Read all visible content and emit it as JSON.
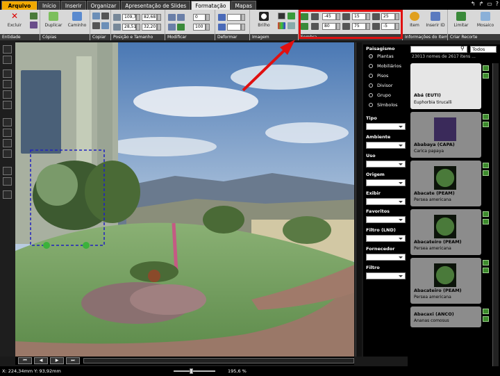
{
  "tabs": [
    "Arquivo",
    "Início",
    "Inserir",
    "Organizar",
    "Apresentação de Slides",
    "Formatação",
    "Mapas"
  ],
  "ribbon": {
    "entidade": {
      "label": "Entidade",
      "buttons": [
        "Excluir"
      ]
    },
    "copias": {
      "label": "Cópias",
      "buttons": [
        "Duplicar",
        "Caminho"
      ]
    },
    "copiar": {
      "label": "Copiar"
    },
    "posicao": {
      "label": "Posição e Tamanho",
      "fields": [
        "109,74",
        "82,68",
        "28,51",
        "32,20"
      ]
    },
    "modificar": {
      "label": "Modificar",
      "fields": [
        "0",
        "100"
      ]
    },
    "deformar": {
      "label": "Deformar"
    },
    "imagem": {
      "label": "Imagem",
      "buttons": [
        "Brilho"
      ]
    },
    "sombra": {
      "label": "Sombra",
      "fields": [
        "-45",
        "15",
        "25",
        "80",
        "75",
        "-5"
      ]
    },
    "info": {
      "label": "Informações do Item",
      "buttons": [
        "Item",
        "Inserir ID"
      ]
    },
    "recorte": {
      "label": "Criar Recorte",
      "buttons": [
        "Limitar",
        "Mosaico"
      ]
    }
  },
  "filters": {
    "paisagismo": {
      "label": "Paisagismo",
      "options": [
        "Plantas",
        "Mobiliários",
        "Pisos",
        "Divisor",
        "Grupo",
        "Símbolos"
      ],
      "selected": "Plantas"
    },
    "dropdowns": [
      "Tipo",
      "Ambiente",
      "Uso",
      "Origem",
      "Exibir",
      "Favoritos",
      "Filtro (LND)",
      "Fornecedor",
      "Filtro"
    ]
  },
  "library": {
    "count_text": "23013 nomes de 2617 itens ...",
    "dropdown": "Todos",
    "items": [
      {
        "name": "Abá (EUTI)",
        "sci": "Euphorbia tirucalli"
      },
      {
        "name": "Ababaya (CAPA)",
        "sci": "Carica papaya"
      },
      {
        "name": "Abacate (PEAM)",
        "sci": "Persea americana"
      },
      {
        "name": "Abacateiro (PEAM)",
        "sci": "Persea americana"
      },
      {
        "name": "Abacateiro (PEAM)",
        "sci": "Persea americana"
      },
      {
        "name": "Abacaxi (ANCO)",
        "sci": "Ananas comosus"
      }
    ]
  },
  "status": {
    "coords": "X: 224,34mm Y: 93,92mm",
    "zoom": "195,6 %"
  },
  "colors": {
    "highlight": "#e01010",
    "file_tab": "#f2a900",
    "sky": "#8aa7c8",
    "grass": "#6d9a5a"
  }
}
